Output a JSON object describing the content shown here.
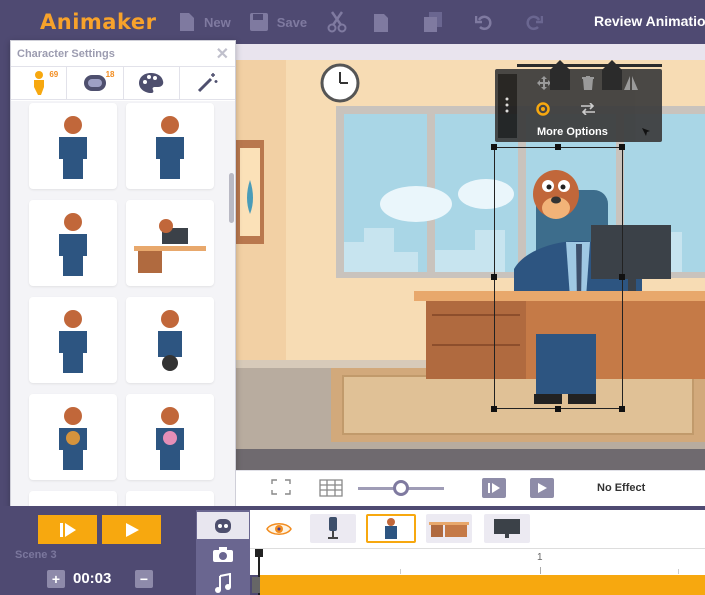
{
  "app": {
    "logo": "Animaker",
    "project_title": "Review Animation"
  },
  "toolbar": {
    "new_label": "New",
    "save_label": "Save"
  },
  "panel": {
    "title": "Character Settings",
    "tabs": [
      {
        "icon": "character-pose-icon",
        "count": "69"
      },
      {
        "icon": "expression-face-icon",
        "count": "18"
      },
      {
        "icon": "palette-icon",
        "count": ""
      },
      {
        "icon": "magic-wand-icon",
        "count": ""
      }
    ]
  },
  "context_menu": {
    "more_options_label": "More Options"
  },
  "controls": {
    "effect_label": "No Effect"
  },
  "timeline": {
    "scene_label": "Scene 3",
    "duration": "00:03",
    "ruler_mark": "1"
  },
  "colors": {
    "brand": "#f7a22b",
    "header_bg": "#4f4a72",
    "accent": "#f7a80f"
  }
}
